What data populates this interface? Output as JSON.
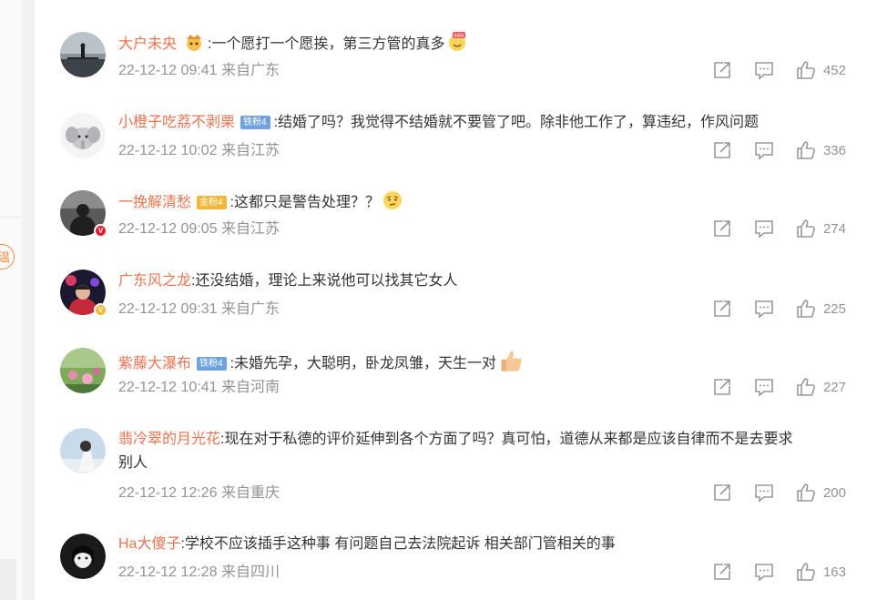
{
  "sidebar": {
    "button_label": "温"
  },
  "comments": [
    {
      "username": "大户未央",
      "has_badge_icon": true,
      "text": ":一个愿打一个愿挨，第三方管的真多",
      "emoji": "emoji-666-icon",
      "time": "22-12-12 09:41",
      "location": "来自广东",
      "likes": "452"
    },
    {
      "username": "小橙子吃荔不剥栗",
      "fan_badge": "铁粉4",
      "text": ":结婚了吗？我觉得不结婚就不要管了吧。除非他工作了，算违纪，作风问题",
      "time": "22-12-12 10:02",
      "location": "来自江苏",
      "likes": "336"
    },
    {
      "username": "一挽解清愁",
      "fan_badge": "金粉4",
      "text": ":这都只是警告处理？？",
      "emoji": "emoji-thinking-icon",
      "time": "22-12-12 09:05",
      "location": "来自江苏",
      "likes": "274"
    },
    {
      "username": "广东风之龙",
      "text": ":还没结婚，理论上来说他可以找其它女人",
      "time": "22-12-12 09:31",
      "location": "来自广东",
      "likes": "225"
    },
    {
      "username": "紫藤大瀑布",
      "fan_badge": "铁粉4",
      "text": ":未婚先孕，大聪明，卧龙凤雏，天生一对",
      "emoji": "emoji-thumbs-up-icon",
      "time": "22-12-12 10:41",
      "location": "来自河南",
      "likes": "227"
    },
    {
      "username": "翡冷翠的月光花",
      "text": ":现在对于私德的评价延伸到各个方面了吗？真可怕，道德从来都是应该自律而不是去要求",
      "text2": "别人",
      "time": "22-12-12 12:26",
      "location": "来自重庆",
      "likes": "200"
    },
    {
      "username": "Ha大傻子",
      "text": ":学校不应该插手这种事 有问题自己去法院起诉 相关部门管相关的事",
      "time": "22-12-12 12:28",
      "location": "来自四川",
      "likes": "163"
    }
  ]
}
